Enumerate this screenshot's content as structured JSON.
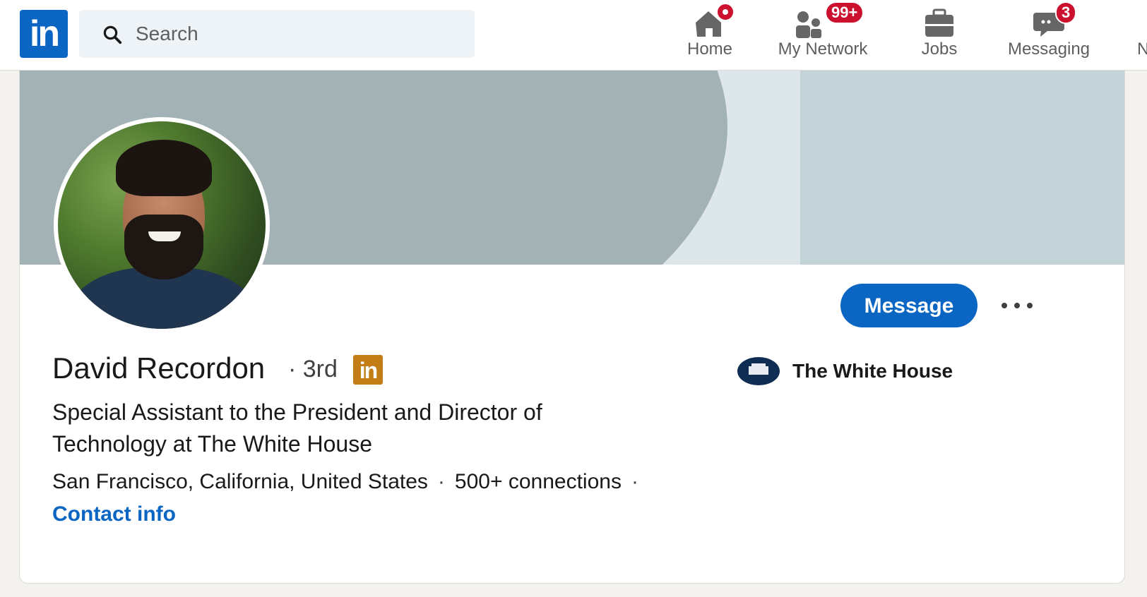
{
  "nav": {
    "logo_text": "in",
    "search_placeholder": "Search",
    "items": [
      {
        "label": "Home",
        "icon": "home-icon",
        "badge": ""
      },
      {
        "label": "My Network",
        "icon": "people-icon",
        "badge": "99+"
      },
      {
        "label": "Jobs",
        "icon": "briefcase-icon",
        "badge": ""
      },
      {
        "label": "Messaging",
        "icon": "chat-icon",
        "badge": "3"
      }
    ],
    "cut_item_label": "N"
  },
  "profile": {
    "name": "David Recordon",
    "degree": "· 3rd",
    "premium_badge": "in",
    "headline": "Special Assistant to the President and Director of Technology at The White House",
    "location": "San Francisco, California, United States",
    "connections": "500+ connections",
    "separator": "·",
    "contact_info": "Contact info",
    "message_button": "Message",
    "company": "The White House"
  },
  "colors": {
    "brand_blue": "#0a66c2",
    "notification_red": "#cb112d",
    "premium_gold": "#c37d16",
    "banner_dark": "#a2b2b5",
    "banner_light": "#c4d3d7"
  }
}
